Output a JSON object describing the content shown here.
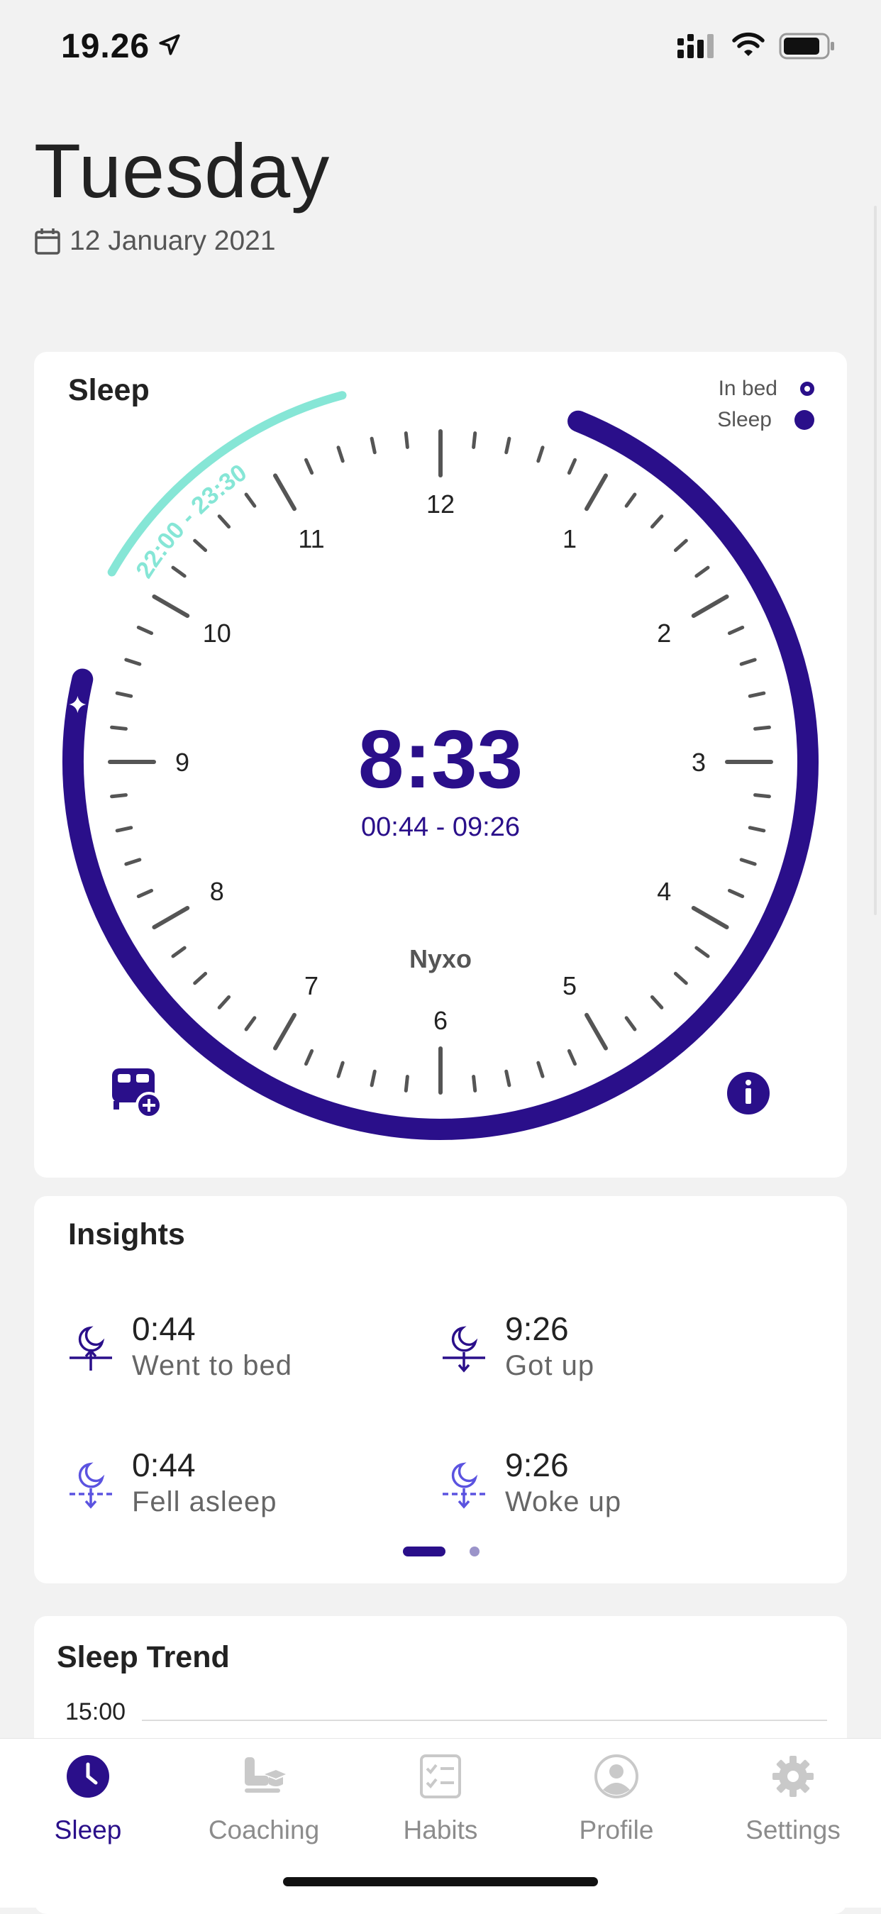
{
  "status": {
    "time": "19.26"
  },
  "header": {
    "title": "Tuesday",
    "date": "12 January 2021"
  },
  "sleep_card": {
    "title": "Sleep",
    "legend": {
      "in_bed": "In bed",
      "sleep": "Sleep"
    },
    "duration": "8:33",
    "range": "00:44 - 09:26",
    "brand": "Nyxo",
    "goal_range": "22:00 - 23:30",
    "hours": [
      "12",
      "1",
      "2",
      "3",
      "4",
      "5",
      "6",
      "7",
      "8",
      "9",
      "10",
      "11"
    ],
    "colors": {
      "sleep": "#2a0f8a",
      "goal": "#86e6d6"
    }
  },
  "insights": {
    "title": "Insights",
    "items": [
      {
        "value": "0:44",
        "label": "Went to bed"
      },
      {
        "value": "9:26",
        "label": "Got up"
      },
      {
        "value": "0:44",
        "label": "Fell  asleep"
      },
      {
        "value": "9:26",
        "label": "Woke up"
      }
    ],
    "page": 1,
    "pages": 2
  },
  "trend": {
    "title": "Sleep Trend",
    "tick": "15:00"
  },
  "tabs": [
    {
      "label": "Sleep",
      "icon": "clock-icon",
      "active": true
    },
    {
      "label": "Coaching",
      "icon": "coaching-icon",
      "active": false
    },
    {
      "label": "Habits",
      "icon": "checklist-icon",
      "active": false
    },
    {
      "label": "Profile",
      "icon": "user-icon",
      "active": false
    },
    {
      "label": "Settings",
      "icon": "gear-icon",
      "active": false
    }
  ]
}
